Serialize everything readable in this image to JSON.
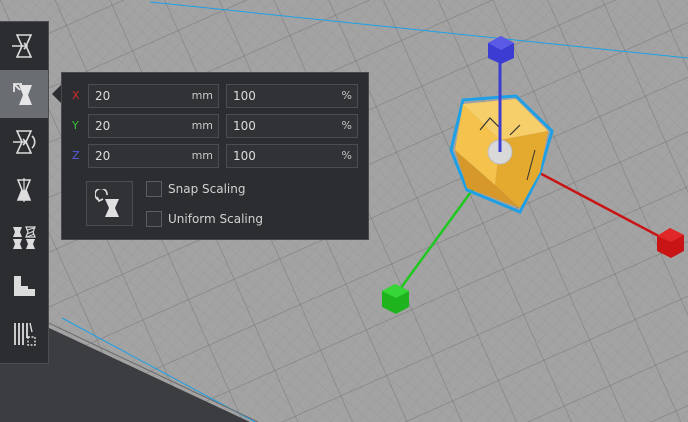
{
  "scale_panel": {
    "rows": [
      {
        "axis": "X",
        "color": "#d22c2c",
        "value": "20",
        "unit": "mm",
        "percent": "100",
        "percent_unit": "%"
      },
      {
        "axis": "Y",
        "color": "#37c437",
        "value": "20",
        "unit": "mm",
        "percent": "100",
        "percent_unit": "%"
      },
      {
        "axis": "Z",
        "color": "#5a5ae6",
        "value": "20",
        "unit": "mm",
        "percent": "100",
        "percent_unit": "%"
      }
    ],
    "snap_scaling": {
      "label": "Snap Scaling",
      "checked": false
    },
    "uniform_scaling": {
      "label": "Uniform Scaling",
      "checked": false
    }
  },
  "toolbar": {
    "tools": [
      {
        "icon": "move-icon",
        "active": false
      },
      {
        "icon": "scale-icon",
        "active": true
      },
      {
        "icon": "rotate-icon",
        "active": false
      },
      {
        "icon": "mirror-icon",
        "active": false
      },
      {
        "icon": "per-model-settings-icon",
        "active": false
      },
      {
        "icon": "support-blocker-icon",
        "active": false
      },
      {
        "icon": "slicing-tool-icon",
        "active": false
      }
    ]
  },
  "colors": {
    "toolbar_bg": "#2b2d30",
    "active_tool": "#6a6d72",
    "model": "#f5c24c",
    "selection_outline": "#1ea0e6",
    "axis_x": "#c81414",
    "axis_y": "#1ec81e",
    "axis_z": "#3c3cd2"
  }
}
